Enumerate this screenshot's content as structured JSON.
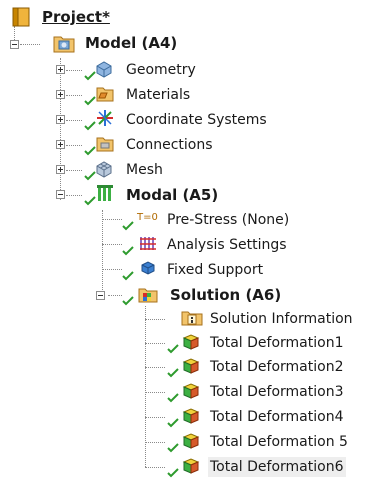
{
  "tree": {
    "project": {
      "label": "Project*"
    },
    "model": {
      "label": "Model (A4)"
    },
    "model_children": [
      {
        "label": "Geometry",
        "icon": "geometry-icon"
      },
      {
        "label": "Materials",
        "icon": "materials-folder-icon"
      },
      {
        "label": "Coordinate Systems",
        "icon": "coordinate-systems-icon"
      },
      {
        "label": "Connections",
        "icon": "connections-folder-icon"
      },
      {
        "label": "Mesh",
        "icon": "mesh-icon"
      }
    ],
    "modal": {
      "label": "Modal (A5)"
    },
    "modal_children": [
      {
        "label": "Pre-Stress (None)",
        "icon": "pre-stress-icon",
        "icon_text": "T=0"
      },
      {
        "label": "Analysis Settings",
        "icon": "analysis-settings-icon"
      },
      {
        "label": "Fixed Support",
        "icon": "fixed-support-icon"
      }
    ],
    "solution": {
      "label": "Solution (A6)"
    },
    "solution_children": [
      {
        "label": "Solution Information",
        "icon": "solution-information-icon"
      },
      {
        "label": "Total Deformation1",
        "icon": "total-deformation-icon"
      },
      {
        "label": "Total Deformation2",
        "icon": "total-deformation-icon"
      },
      {
        "label": "Total Deformation3",
        "icon": "total-deformation-icon"
      },
      {
        "label": "Total Deformation4",
        "icon": "total-deformation-icon"
      },
      {
        "label": "Total Deformation 5",
        "icon": "total-deformation-icon"
      },
      {
        "label": "Total Deformation6",
        "icon": "total-deformation-icon",
        "selected": true
      }
    ]
  },
  "colors": {
    "check": "#2e9b2e",
    "folder": "#e6a23c",
    "modal": "#3cb043",
    "selected_bg": "#eeeeee"
  }
}
